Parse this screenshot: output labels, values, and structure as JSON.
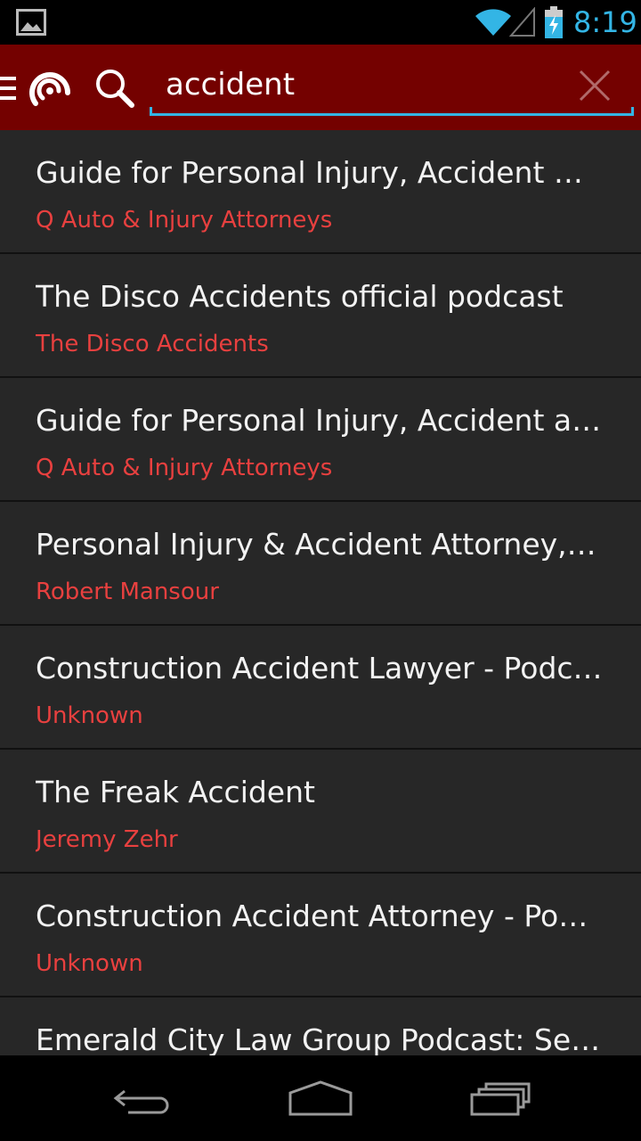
{
  "status_bar": {
    "time": "8:19",
    "icons": [
      "image-notification-icon",
      "wifi-icon",
      "signal-icon",
      "battery-charging-icon"
    ]
  },
  "action_bar": {
    "search_value": "accident",
    "icons": [
      "menu-icon",
      "app-logo-icon",
      "search-icon",
      "clear-icon"
    ],
    "background_color": "#740100",
    "accent_color": "#33b5e5"
  },
  "results": [
    {
      "title": "Guide for Personal Injury, Accident & Work Comp",
      "author": "Q Auto & Injury Attorneys"
    },
    {
      "title": "The Disco Accidents official podcast",
      "author": "The Disco Accidents"
    },
    {
      "title": "Guide for Personal Injury, Accident and Work Comp",
      "author": "Q Auto & Injury Attorneys"
    },
    {
      "title": "Personal Injury & Accident Attorney, Esq.",
      "author": "Robert Mansour"
    },
    {
      "title": "Construction Accident Lawyer - Podcast",
      "author": "Unknown"
    },
    {
      "title": "The Freak Accident",
      "author": "Jeremy Zehr"
    },
    {
      "title": "Construction Accident Attorney - Podcast",
      "author": "Unknown"
    },
    {
      "title": "Emerald City Law Group Podcast: Seattle",
      "author": ""
    }
  ],
  "nav_bar": {
    "icons": [
      "back-icon",
      "home-icon",
      "recent-apps-icon"
    ]
  },
  "colors": {
    "author_text": "#e8403f",
    "title_text": "#f2f2f2",
    "list_background": "#272727"
  }
}
